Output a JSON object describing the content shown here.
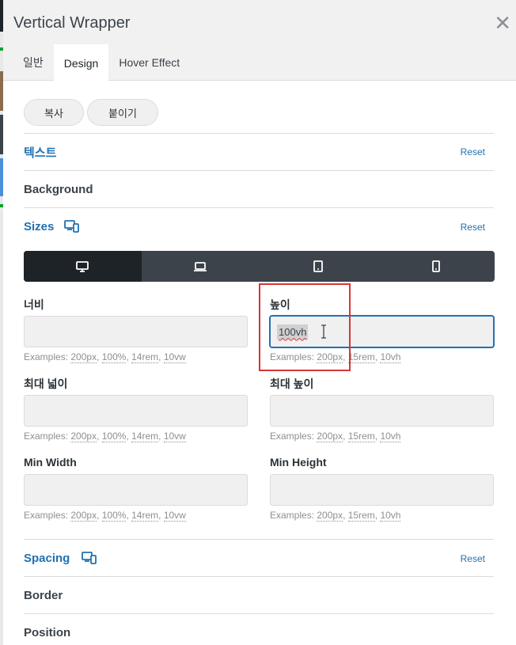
{
  "window": {
    "title": "Vertical Wrapper",
    "close_icon": "close-icon"
  },
  "tabs": [
    {
      "label": "일반",
      "active": false
    },
    {
      "label": "Design",
      "active": true
    },
    {
      "label": "Hover Effect",
      "active": false
    }
  ],
  "actions": {
    "copy_label": "복사",
    "paste_label": "붙이기"
  },
  "sections": {
    "text": {
      "label": "텍스트",
      "reset": "Reset"
    },
    "background": {
      "label": "Background"
    },
    "sizes": {
      "label": "Sizes",
      "reset": "Reset"
    },
    "spacing": {
      "label": "Spacing",
      "reset": "Reset"
    },
    "border": {
      "label": "Border"
    },
    "position": {
      "label": "Position"
    }
  },
  "devices": [
    {
      "name": "desktop-icon",
      "active": true
    },
    {
      "name": "laptop-icon",
      "active": false
    },
    {
      "name": "tablet-icon",
      "active": false
    },
    {
      "name": "mobile-icon",
      "active": false
    }
  ],
  "fields": {
    "width": {
      "label": "너비",
      "value": "",
      "prefix": "Examples:",
      "examples": [
        "200px",
        "100%",
        "14rem",
        "10vw"
      ]
    },
    "height": {
      "label": "높이",
      "value": "100vh",
      "prefix": "Examples:",
      "examples": [
        "200px",
        "15rem",
        "10vh"
      ]
    },
    "max_width": {
      "label": "최대 넓이",
      "value": "",
      "prefix": "Examples:",
      "examples": [
        "200px",
        "100%",
        "14rem",
        "10vw"
      ]
    },
    "max_height": {
      "label": "최대 높이",
      "value": "",
      "prefix": "Examples:",
      "examples": [
        "200px",
        "15rem",
        "10vh"
      ]
    },
    "min_width": {
      "label": "Min Width",
      "value": "",
      "prefix": "Examples:",
      "examples": [
        "200px",
        "100%",
        "14rem",
        "10vw"
      ]
    },
    "min_height": {
      "label": "Min Height",
      "value": "",
      "prefix": "Examples:",
      "examples": [
        "200px",
        "15rem",
        "10vh"
      ]
    }
  },
  "colors": {
    "accent": "#2271b1",
    "highlight_box": "#d63638",
    "device_bar": "#3c434a",
    "device_active": "#1d2327"
  }
}
